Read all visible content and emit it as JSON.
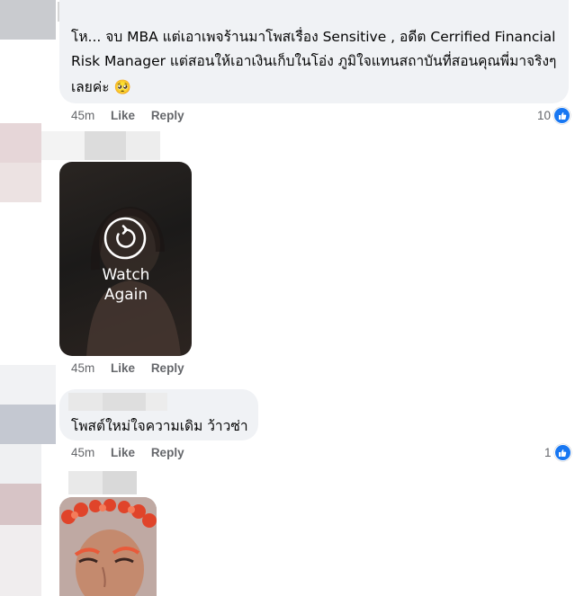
{
  "comments": [
    {
      "text_lines": [
        "โห... จบ MBA แต่เอาเพจร้านมาโพสเรื่อง Sensitive , อดีต Cerrified Financial",
        "Risk Manager แต่สอนให้เอาเงินเก็บในโอ่ง  ภูมิใจแทนสถาบันที่สอนคุณพี่มาจริงๆ",
        "เลยค่ะ 🥺"
      ],
      "time": "45m",
      "like_label": "Like",
      "reply_label": "Reply",
      "reaction_count": "10"
    },
    {
      "video_overlay_label": "Watch Again",
      "time": "45m",
      "like_label": "Like",
      "reply_label": "Reply"
    },
    {
      "text": "โพสต์ใหม่ใจความเดิม ว้าวซ่า",
      "time": "45m",
      "like_label": "Like",
      "reply_label": "Reply",
      "reaction_count": "1"
    }
  ],
  "colors": {
    "bubble": "#f0f2f5",
    "meta_text": "#65676b",
    "like_blue": "#1877f2"
  },
  "icons": [
    "replay-icon",
    "like-reaction-icon",
    "pleading-face-emoji"
  ]
}
